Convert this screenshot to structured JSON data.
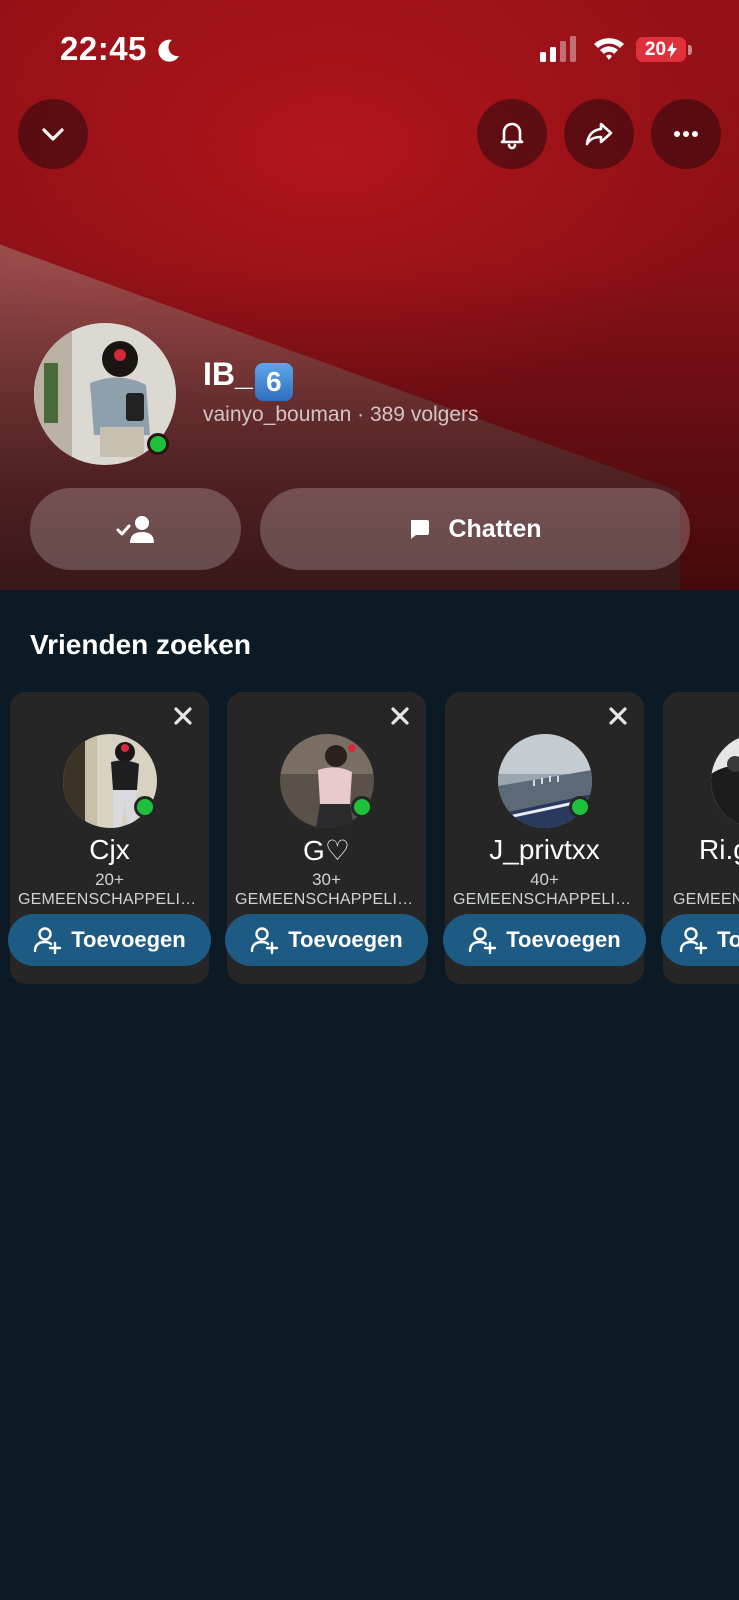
{
  "status_bar": {
    "time": "22:45",
    "battery": "20"
  },
  "header": {
    "collapse_icon": "chevron-down-icon",
    "notification_icon": "bell-icon",
    "share_icon": "share-arrow-icon",
    "more_icon": "ellipsis-icon"
  },
  "profile": {
    "display_name": "IB_",
    "display_emoji": "6",
    "username": "vainyo_bouman",
    "separator": " · ",
    "followers": "389 volgers",
    "online": true
  },
  "actions": {
    "friend_status_icon": "friend-check-icon",
    "chat_label": "Chatten"
  },
  "find_friends": {
    "title": "Vrienden zoeken",
    "cards": [
      {
        "name": "Cjx",
        "age": "20+",
        "mutual": "GEMEENSCHAPPELIJKE VRIENDEN",
        "add_label": "Toevoegen",
        "online": true
      },
      {
        "name": "G♡",
        "age": "30+",
        "mutual": "GEMEENSCHAPPELIJKE VRIENDEN",
        "add_label": "Toevoegen",
        "online": true
      },
      {
        "name": "J_privtxx",
        "age": "40+",
        "mutual": "GEMEENSCHAPPELIJKE VRIENDEN",
        "add_label": "Toevoegen",
        "online": true
      },
      {
        "name": "Ri.g",
        "age": "",
        "mutual": "GEMEENSCHAPPELIJKE VRIENDEN",
        "add_label": "Toevoegen",
        "online": false
      }
    ]
  },
  "colors": {
    "background": "#0b1a24",
    "hero_red": "#951117",
    "card_bg": "#262626",
    "add_button": "#1d5b84",
    "online": "#1ec13b",
    "battery_low": "#e0303b"
  }
}
